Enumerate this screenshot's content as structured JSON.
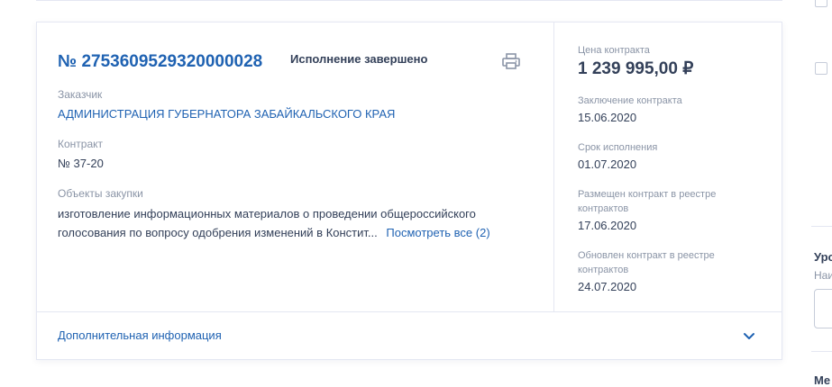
{
  "card": {
    "reg_number": "№ 2753609529320000028",
    "status": "Исполнение завершено",
    "print_icon": "printer-icon",
    "customer_label": "Заказчик",
    "customer_name": "АДМИНИСТРАЦИЯ ГУБЕРНАТОРА ЗАБАЙКАЛЬСКОГО КРАЯ",
    "contract_label": "Контракт",
    "contract_number": "№ 37-20",
    "objects_label": "Объекты закупки",
    "objects_text": "изготовление информационных материалов о проведении общероссийского голосования по вопросу одобрения изменений в Констит...",
    "objects_link": "Посмотреть все (2)"
  },
  "sidebar": {
    "price_label": "Цена контракта",
    "price_value": "1 239 995,00 ₽",
    "conclusion_label": "Заключение контракта",
    "conclusion_date": "15.06.2020",
    "term_label": "Срок исполнения",
    "term_date": "01.07.2020",
    "placed_label": "Размещен контракт в реестре контрактов",
    "placed_date": "17.06.2020",
    "updated_label": "Обновлен контракт в реестре контрактов",
    "updated_date": "24.07.2020"
  },
  "footer": {
    "label": "Дополнительная информация",
    "chevron_icon": "chevron-down-icon"
  },
  "right_panel": {
    "heading_fragment": "Уро",
    "subtext_fragment": "Наи",
    "bottom_fragment": "Ме"
  },
  "colors": {
    "accent": "#1f62b2",
    "text": "#334059",
    "muted": "#8a94a6",
    "border": "#e4e7f2"
  }
}
